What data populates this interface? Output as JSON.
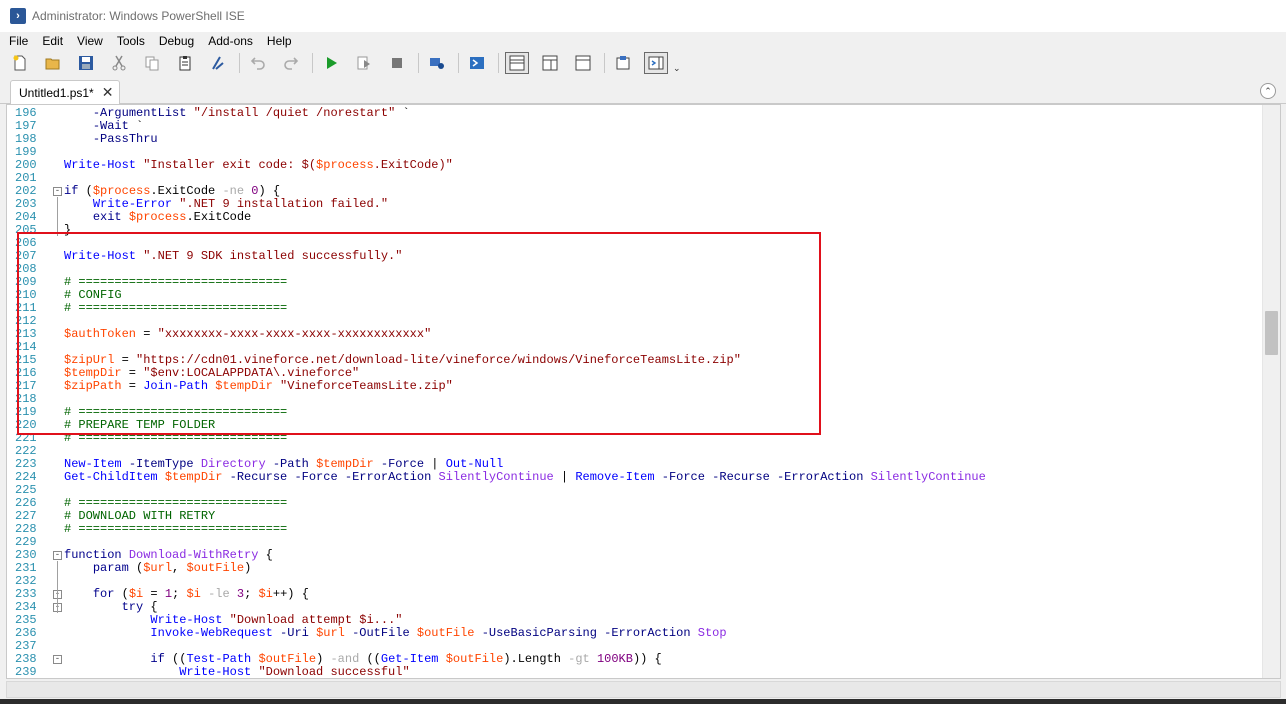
{
  "window": {
    "title": "Administrator: Windows PowerShell ISE"
  },
  "menu": [
    "File",
    "Edit",
    "View",
    "Tools",
    "Debug",
    "Add-ons",
    "Help"
  ],
  "toolbar": {
    "icons": [
      "new-icon",
      "open-icon",
      "save-icon",
      "cut-icon",
      "copy-icon",
      "paste-icon",
      "clear-icon",
      "undo-icon",
      "redo-icon",
      "run-icon",
      "run-selection-icon",
      "stop-icon",
      "remote-icon",
      "powershell-icon",
      "layout-top-icon",
      "layout-right-icon",
      "layout-max-icon",
      "show-commands-icon",
      "show-addon-icon"
    ]
  },
  "tabs": [
    {
      "label": "Untitled1.ps1*",
      "close": "✕"
    }
  ],
  "collapse_button": "⌃",
  "editor": {
    "lines": [
      {
        "n": "196",
        "tokens": [
          [
            "plain",
            "    "
          ],
          [
            "param",
            "-ArgumentList"
          ],
          [
            "plain",
            " "
          ],
          [
            "str",
            "\"/install /quiet /norestart\""
          ],
          [
            "plain",
            " `"
          ]
        ]
      },
      {
        "n": "197",
        "tokens": [
          [
            "plain",
            "    "
          ],
          [
            "param",
            "-Wait"
          ],
          [
            "plain",
            " `"
          ]
        ]
      },
      {
        "n": "198",
        "tokens": [
          [
            "plain",
            "    "
          ],
          [
            "param",
            "-PassThru"
          ]
        ]
      },
      {
        "n": "199",
        "tokens": []
      },
      {
        "n": "200",
        "tokens": [
          [
            "cmd",
            "Write-Host"
          ],
          [
            "plain",
            " "
          ],
          [
            "str",
            "\"Installer exit code: $("
          ],
          [
            "var",
            "$process"
          ],
          [
            "str",
            ".ExitCode)\""
          ]
        ]
      },
      {
        "n": "201",
        "tokens": []
      },
      {
        "n": "202",
        "fold": "-",
        "tokens": [
          [
            "kw",
            "if"
          ],
          [
            "plain",
            " ("
          ],
          [
            "var",
            "$process"
          ],
          [
            "plain",
            ".ExitCode "
          ],
          [
            "op",
            "-ne"
          ],
          [
            "plain",
            " "
          ],
          [
            "num",
            "0"
          ],
          [
            "plain",
            ") {"
          ]
        ]
      },
      {
        "n": "203",
        "tokens": [
          [
            "plain",
            "    "
          ],
          [
            "cmd",
            "Write-Error"
          ],
          [
            "plain",
            " "
          ],
          [
            "str",
            "\".NET 9 installation failed.\""
          ]
        ]
      },
      {
        "n": "204",
        "tokens": [
          [
            "plain",
            "    "
          ],
          [
            "kw",
            "exit"
          ],
          [
            "plain",
            " "
          ],
          [
            "var",
            "$process"
          ],
          [
            "plain",
            ".ExitCode"
          ]
        ]
      },
      {
        "n": "205",
        "tokens": [
          [
            "plain",
            "}"
          ]
        ]
      },
      {
        "n": "206",
        "tokens": []
      },
      {
        "n": "207",
        "tokens": [
          [
            "cmd",
            "Write-Host"
          ],
          [
            "plain",
            " "
          ],
          [
            "str",
            "\".NET 9 SDK installed successfully.\""
          ]
        ]
      },
      {
        "n": "208",
        "tokens": []
      },
      {
        "n": "209",
        "tokens": [
          [
            "cmt",
            "# ============================="
          ]
        ]
      },
      {
        "n": "210",
        "tokens": [
          [
            "cmt",
            "# CONFIG"
          ]
        ]
      },
      {
        "n": "211",
        "tokens": [
          [
            "cmt",
            "# ============================="
          ]
        ]
      },
      {
        "n": "212",
        "tokens": []
      },
      {
        "n": "213",
        "tokens": [
          [
            "var",
            "$authToken"
          ],
          [
            "plain",
            " = "
          ],
          [
            "str",
            "\"xxxxxxxx-xxxx-xxxx-xxxx-xxxxxxxxxxxx\""
          ]
        ]
      },
      {
        "n": "214",
        "tokens": []
      },
      {
        "n": "215",
        "tokens": [
          [
            "var",
            "$zipUrl"
          ],
          [
            "plain",
            " = "
          ],
          [
            "str",
            "\"https://cdn01.vineforce.net/download-lite/vineforce/windows/VineforceTeamsLite.zip\""
          ]
        ]
      },
      {
        "n": "216",
        "tokens": [
          [
            "var",
            "$tempDir"
          ],
          [
            "plain",
            " = "
          ],
          [
            "str",
            "\"$env:LOCALAPPDATA\\.vineforce\""
          ]
        ]
      },
      {
        "n": "217",
        "tokens": [
          [
            "var",
            "$zipPath"
          ],
          [
            "plain",
            " = "
          ],
          [
            "cmd",
            "Join-Path"
          ],
          [
            "plain",
            " "
          ],
          [
            "var",
            "$tempDir"
          ],
          [
            "plain",
            " "
          ],
          [
            "str",
            "\"VineforceTeamsLite.zip\""
          ]
        ]
      },
      {
        "n": "218",
        "tokens": []
      },
      {
        "n": "219",
        "tokens": [
          [
            "cmt",
            "# ============================="
          ]
        ]
      },
      {
        "n": "220",
        "tokens": [
          [
            "cmt",
            "# PREPARE TEMP FOLDER"
          ]
        ]
      },
      {
        "n": "221",
        "tokens": [
          [
            "cmt",
            "# ============================="
          ]
        ]
      },
      {
        "n": "222",
        "tokens": []
      },
      {
        "n": "223",
        "tokens": [
          [
            "cmd",
            "New-Item"
          ],
          [
            "plain",
            " "
          ],
          [
            "param",
            "-ItemType"
          ],
          [
            "plain",
            " "
          ],
          [
            "type",
            "Directory"
          ],
          [
            "plain",
            " "
          ],
          [
            "param",
            "-Path"
          ],
          [
            "plain",
            " "
          ],
          [
            "var",
            "$tempDir"
          ],
          [
            "plain",
            " "
          ],
          [
            "param",
            "-Force"
          ],
          [
            "plain",
            " | "
          ],
          [
            "cmd",
            "Out-Null"
          ]
        ]
      },
      {
        "n": "224",
        "tokens": [
          [
            "cmd",
            "Get-ChildItem"
          ],
          [
            "plain",
            " "
          ],
          [
            "var",
            "$tempDir"
          ],
          [
            "plain",
            " "
          ],
          [
            "param",
            "-Recurse"
          ],
          [
            "plain",
            " "
          ],
          [
            "param",
            "-Force"
          ],
          [
            "plain",
            " "
          ],
          [
            "param",
            "-ErrorAction"
          ],
          [
            "plain",
            " "
          ],
          [
            "type",
            "SilentlyContinue"
          ],
          [
            "plain",
            " | "
          ],
          [
            "cmd",
            "Remove-Item"
          ],
          [
            "plain",
            " "
          ],
          [
            "param",
            "-Force"
          ],
          [
            "plain",
            " "
          ],
          [
            "param",
            "-Recurse"
          ],
          [
            "plain",
            " "
          ],
          [
            "param",
            "-ErrorAction"
          ],
          [
            "plain",
            " "
          ],
          [
            "type",
            "SilentlyContinue"
          ]
        ]
      },
      {
        "n": "225",
        "tokens": []
      },
      {
        "n": "226",
        "tokens": [
          [
            "cmt",
            "# ============================="
          ]
        ]
      },
      {
        "n": "227",
        "tokens": [
          [
            "cmt",
            "# DOWNLOAD WITH RETRY"
          ]
        ]
      },
      {
        "n": "228",
        "tokens": [
          [
            "cmt",
            "# ============================="
          ]
        ]
      },
      {
        "n": "229",
        "tokens": []
      },
      {
        "n": "230",
        "fold": "-",
        "tokens": [
          [
            "kw",
            "function"
          ],
          [
            "plain",
            " "
          ],
          [
            "type",
            "Download-WithRetry"
          ],
          [
            "plain",
            " {"
          ]
        ]
      },
      {
        "n": "231",
        "tokens": [
          [
            "plain",
            "    "
          ],
          [
            "kw",
            "param"
          ],
          [
            "plain",
            " ("
          ],
          [
            "var",
            "$url"
          ],
          [
            "plain",
            ", "
          ],
          [
            "var",
            "$outFile"
          ],
          [
            "plain",
            ")"
          ]
        ]
      },
      {
        "n": "232",
        "tokens": []
      },
      {
        "n": "233",
        "fold": "-",
        "tokens": [
          [
            "plain",
            "    "
          ],
          [
            "kw",
            "for"
          ],
          [
            "plain",
            " ("
          ],
          [
            "var",
            "$i"
          ],
          [
            "plain",
            " = "
          ],
          [
            "num",
            "1"
          ],
          [
            "plain",
            "; "
          ],
          [
            "var",
            "$i"
          ],
          [
            "plain",
            " "
          ],
          [
            "op",
            "-le"
          ],
          [
            "plain",
            " "
          ],
          [
            "num",
            "3"
          ],
          [
            "plain",
            "; "
          ],
          [
            "var",
            "$i"
          ],
          [
            "plain",
            "++) {"
          ]
        ]
      },
      {
        "n": "234",
        "fold": "-",
        "tokens": [
          [
            "plain",
            "        "
          ],
          [
            "kw",
            "try"
          ],
          [
            "plain",
            " {"
          ]
        ]
      },
      {
        "n": "235",
        "tokens": [
          [
            "plain",
            "            "
          ],
          [
            "cmd",
            "Write-Host"
          ],
          [
            "plain",
            " "
          ],
          [
            "str",
            "\"Download attempt $i...\""
          ]
        ]
      },
      {
        "n": "236",
        "tokens": [
          [
            "plain",
            "            "
          ],
          [
            "cmd",
            "Invoke-WebRequest"
          ],
          [
            "plain",
            " "
          ],
          [
            "param",
            "-Uri"
          ],
          [
            "plain",
            " "
          ],
          [
            "var",
            "$url"
          ],
          [
            "plain",
            " "
          ],
          [
            "param",
            "-OutFile"
          ],
          [
            "plain",
            " "
          ],
          [
            "var",
            "$outFile"
          ],
          [
            "plain",
            " "
          ],
          [
            "param",
            "-UseBasicParsing"
          ],
          [
            "plain",
            " "
          ],
          [
            "param",
            "-ErrorAction"
          ],
          [
            "plain",
            " "
          ],
          [
            "type",
            "Stop"
          ]
        ]
      },
      {
        "n": "237",
        "tokens": []
      },
      {
        "n": "238",
        "fold": "-",
        "tokens": [
          [
            "plain",
            "            "
          ],
          [
            "kw",
            "if"
          ],
          [
            "plain",
            " (("
          ],
          [
            "cmd",
            "Test-Path"
          ],
          [
            "plain",
            " "
          ],
          [
            "var",
            "$outFile"
          ],
          [
            "plain",
            ") "
          ],
          [
            "op",
            "-and"
          ],
          [
            "plain",
            " (("
          ],
          [
            "cmd",
            "Get-Item"
          ],
          [
            "plain",
            " "
          ],
          [
            "var",
            "$outFile"
          ],
          [
            "plain",
            ").Length "
          ],
          [
            "op",
            "-gt"
          ],
          [
            "plain",
            " "
          ],
          [
            "num",
            "100KB"
          ],
          [
            "plain",
            ")) {"
          ]
        ]
      },
      {
        "n": "239",
        "tokens": [
          [
            "plain",
            "                "
          ],
          [
            "cmd",
            "Write-Host"
          ],
          [
            "plain",
            " "
          ],
          [
            "str",
            "\"Download successful\""
          ]
        ]
      }
    ]
  }
}
